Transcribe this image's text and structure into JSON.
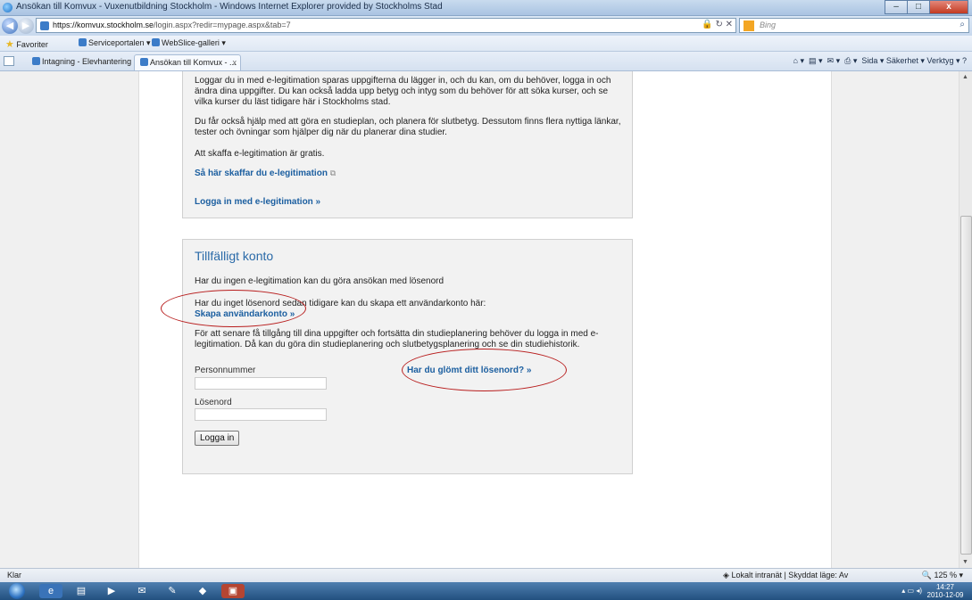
{
  "window": {
    "title": "Ansökan till Komvux - Vuxenutbildning Stockholm - Windows Internet Explorer provided by Stockholms Stad",
    "minimize": "–",
    "maximize": "□",
    "close": "x"
  },
  "address": {
    "url_host": "https://komvux.stockholm.se",
    "url_path": "/login.aspx?redir=mypage.aspx&tab=7",
    "search_placeholder": "Bing"
  },
  "favorites": {
    "label": "Favoriter",
    "items": [
      "Serviceportalen ▾",
      "WebSlice-galleri ▾"
    ]
  },
  "tabs": [
    {
      "label": "Intagning - Elevhantering"
    },
    {
      "label": "Ansökan till Komvux - ...",
      "close": "x"
    }
  ],
  "commandbar": "Sida ▾   Säkerhet ▾   Verktyg ▾",
  "eleg_box": {
    "p1": "Loggar du in med e-legitimation sparas uppgifterna du lägger in, och du kan, om du behöver, logga in och ändra dina uppgifter. Du kan också ladda upp betyg och intyg som du behöver för att söka kurser, och se vilka kurser du läst tidigare här i Stockholms stad.",
    "p2": "Du får också hjälp med att göra en studieplan, och planera för slutbetyg. Dessutom finns flera nyttiga länkar, tester och övningar som hjälper dig när du planerar dina studier.",
    "p3": "Att skaffa e-legitimation är gratis.",
    "link_how": "Så här skaffar du e-legitimation",
    "link_login": "Logga in med e-legitimation »"
  },
  "temp_box": {
    "heading": "Tillfälligt konto",
    "p1": "Har du ingen e-legitimation kan du göra ansökan med lösenord",
    "p2": "Har du inget lösenord sedan tidigare kan du skapa ett användarkonto här:",
    "link_create": "Skapa användarkonto »",
    "p3": "För att senare få tillgång till dina uppgifter och fortsätta din studieplanering behöver du logga in med e-legitimation. Då kan du göra din studieplanering och slutbetygsplanering och se din studiehistorik.",
    "label_pnr": "Personnummer",
    "label_pwd": "Lösenord",
    "link_forgot": "Har du glömt ditt lösenord? »",
    "login_button": "Logga in"
  },
  "status": {
    "left": "Klar",
    "zone": "Lokalt intranät | Skyddat läge: Av",
    "zoom": "125 %"
  },
  "clock": {
    "time": "14:27",
    "date": "2010-12-09"
  },
  "colors": {
    "link": "#1c5fa0",
    "heading": "#2a6aa8",
    "annotation": "#b81d1d"
  }
}
